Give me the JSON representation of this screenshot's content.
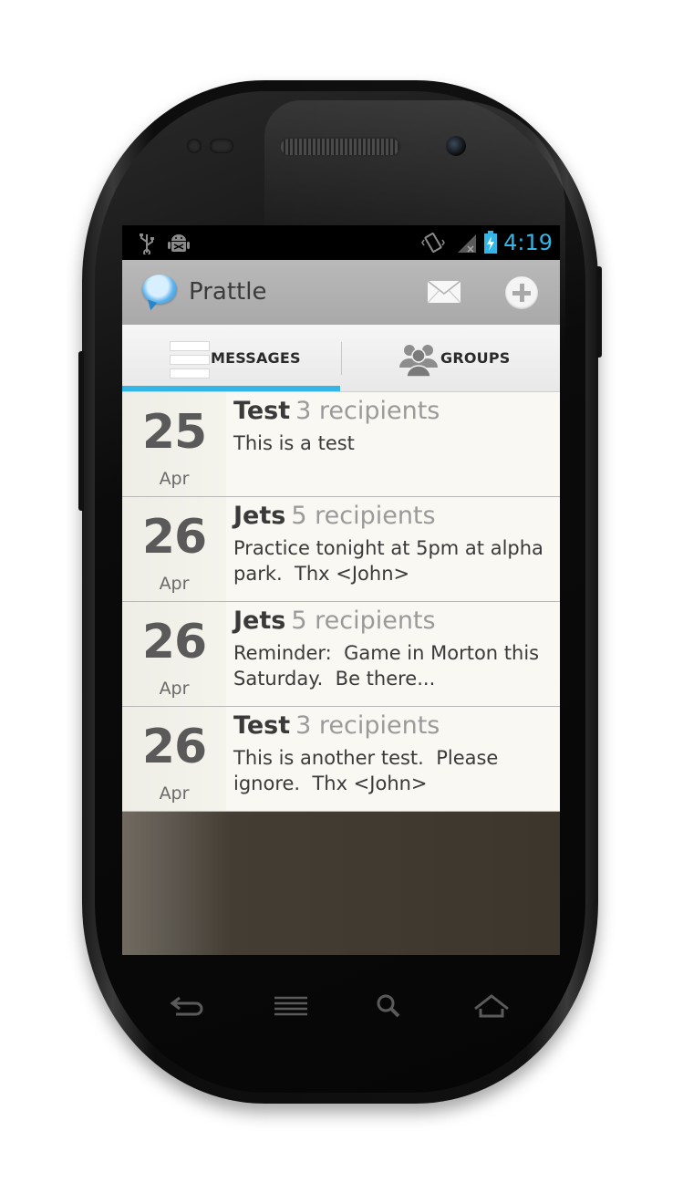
{
  "status_bar": {
    "time": "4:19",
    "icons": [
      "usb-icon",
      "android-debug-icon",
      "vibrate-icon",
      "signal-icon",
      "battery-charging-icon"
    ]
  },
  "action_bar": {
    "title": "Prattle",
    "icon": "prattle-logo-icon",
    "actions": [
      "compose-mail-icon",
      "add-icon"
    ]
  },
  "tabs": [
    {
      "label": "MESSAGES",
      "icon": "messages-icon",
      "selected": true
    },
    {
      "label": "GROUPS",
      "icon": "groups-icon",
      "selected": false
    }
  ],
  "messages": [
    {
      "day": "25",
      "month": "Apr",
      "group": "Test",
      "recipients": "3 recipients",
      "body": "This is a test"
    },
    {
      "day": "26",
      "month": "Apr",
      "group": "Jets",
      "recipients": "5 recipients",
      "body": "Practice tonight at 5pm at alpha park.  Thx <John>"
    },
    {
      "day": "26",
      "month": "Apr",
      "group": "Jets",
      "recipients": "5 recipients",
      "body": "Reminder:  Game in Morton this Saturday.  Be there..."
    },
    {
      "day": "26",
      "month": "Apr",
      "group": "Test",
      "recipients": "3 recipients",
      "body": "This is another test.  Please ignore.  Thx <John>"
    }
  ],
  "nav_keys": [
    "back-icon",
    "menu-icon",
    "search-icon",
    "home-icon"
  ],
  "colors": {
    "accent": "#33b5e5",
    "list_bg": "#f9f8f2",
    "action_bar": "#b0b0b0"
  }
}
